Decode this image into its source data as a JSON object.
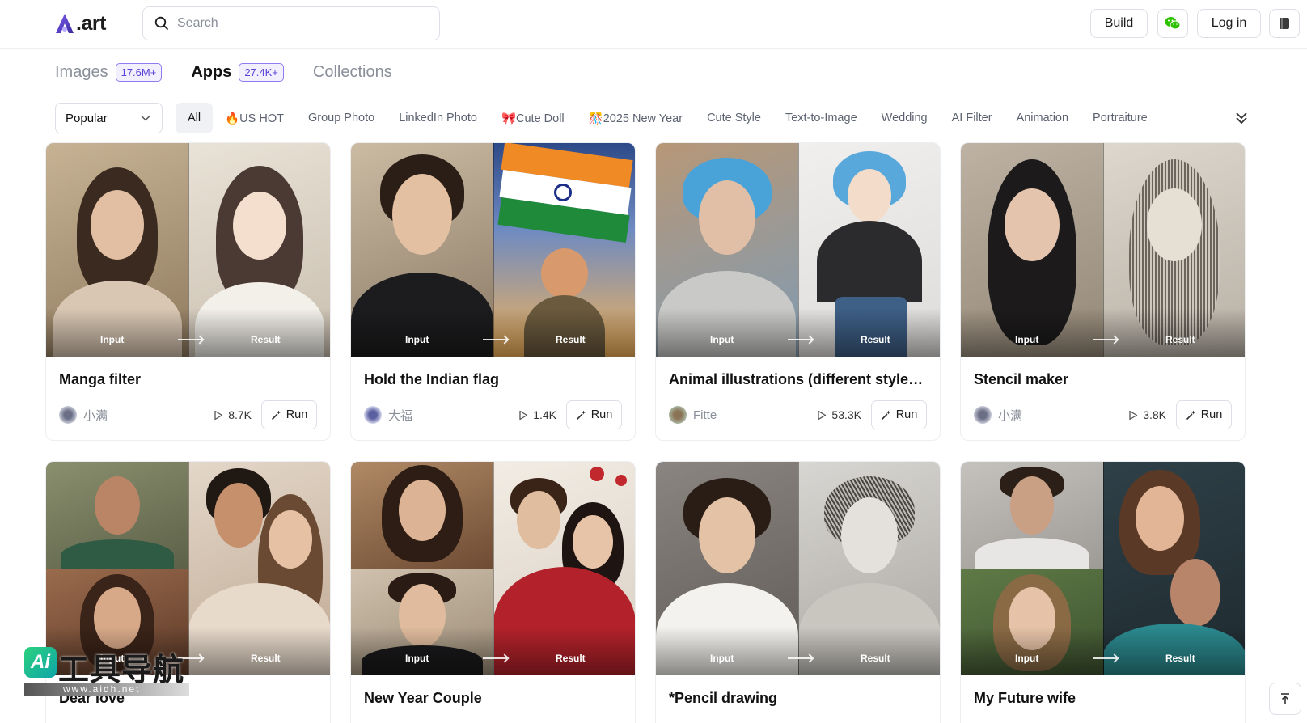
{
  "header": {
    "logo_text": ".art",
    "search_placeholder": "Search",
    "build_label": "Build",
    "login_label": "Log in",
    "wechat_icon": "wechat-icon",
    "book_icon": "book-icon"
  },
  "tabs": [
    {
      "label": "Images",
      "badge": "17.6M+"
    },
    {
      "label": "Apps",
      "badge": "27.4K+",
      "active": true
    },
    {
      "label": "Collections"
    }
  ],
  "sort": {
    "selected": "Popular"
  },
  "filters": [
    "All",
    "🔥US HOT",
    "Group Photo",
    "LinkedIn Photo",
    "🎀Cute Doll",
    "🎊2025 New Year",
    "Cute Style",
    "Text-to-Image",
    "Wedding",
    "AI Filter",
    "Animation",
    "Portraiture"
  ],
  "image_labels": {
    "input": "Input",
    "result": "Result"
  },
  "run_label": "Run",
  "cards": [
    {
      "title": "Manga filter",
      "author": "小满",
      "runs": "8.7K"
    },
    {
      "title": "Hold the Indian flag",
      "author": "大福",
      "runs": "1.4K"
    },
    {
      "title": "Animal illustrations (different styles ...",
      "author": "Fitte",
      "runs": "53.3K"
    },
    {
      "title": "Stencil maker",
      "author": "小满",
      "runs": "3.8K"
    },
    {
      "title": "Dear love"
    },
    {
      "title": "New Year Couple"
    },
    {
      "title": "*Pencil drawing"
    },
    {
      "title": "My Future wife"
    }
  ],
  "watermark": {
    "title": "工具导航",
    "badge": "Ai",
    "url": "www.aidh.net"
  },
  "colors": {
    "accent": "#5b45d6",
    "badge_bg": "#f2efff",
    "wechat": "#2dc100"
  }
}
